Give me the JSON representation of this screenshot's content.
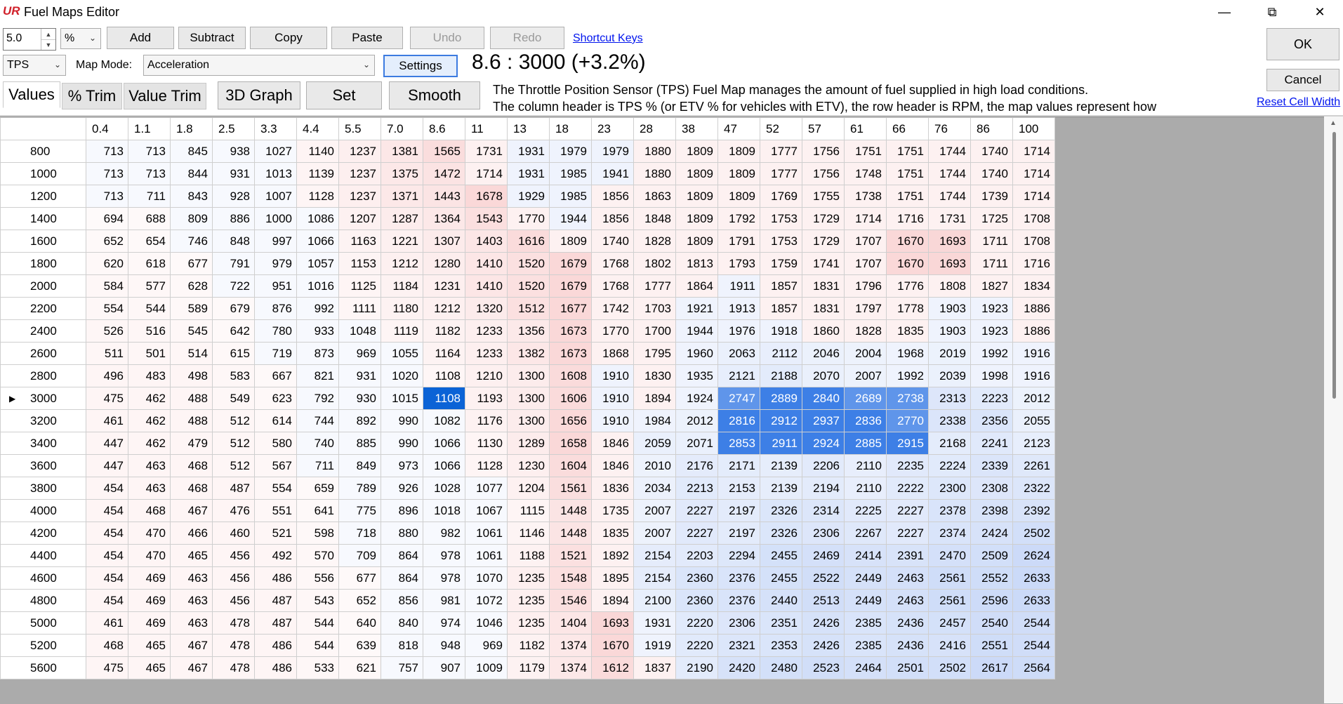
{
  "window": {
    "title": "Fuel Maps Editor",
    "logo": "UR",
    "minimize_label": "—",
    "restore_label": "⧉",
    "close_label": "✕"
  },
  "toolbar": {
    "step_value": "5.0",
    "unit": "%",
    "add_label": "Add",
    "subtract_label": "Subtract",
    "copy_label": "Copy",
    "paste_label": "Paste",
    "undo_label": "Undo",
    "redo_label": "Redo",
    "shortcut_keys_label": "Shortcut Keys",
    "ok_label": "OK",
    "cancel_label": "Cancel",
    "reset_cell_width_label": "Reset Cell Width"
  },
  "map_controls": {
    "sensor": "TPS",
    "map_mode_label": "Map Mode:",
    "map_mode_value": "Acceleration",
    "settings_label": "Settings",
    "readout": "8.6 : 3000 (+3.2%)"
  },
  "tabs": {
    "values": "Values",
    "pct_trim": "% Trim",
    "value_trim": "Value Trim"
  },
  "actions": {
    "graph3d": "3D Graph",
    "set": "Set",
    "smooth": "Smooth"
  },
  "description": {
    "line1": "The Throttle Position Sensor (TPS) Fuel Map manages the amount of fuel supplied in high load conditions.",
    "line2": "The column header is TPS % (or ETV % for vehicles with ETV), the row header is RPM, the map values represent how"
  },
  "grid": {
    "columns": [
      "0.4",
      "1.1",
      "1.8",
      "2.5",
      "3.3",
      "4.4",
      "5.5",
      "7.0",
      "8.6",
      "11",
      "13",
      "18",
      "23",
      "28",
      "38",
      "47",
      "52",
      "57",
      "61",
      "66",
      "76",
      "86",
      "100"
    ],
    "rows": [
      {
        "rpm": "800",
        "values": [
          713,
          713,
          845,
          938,
          1027,
          1140,
          1237,
          1381,
          1565,
          1731,
          1931,
          1979,
          1979,
          1880,
          1809,
          1809,
          1777,
          1756,
          1751,
          1751,
          1744,
          1740,
          1714
        ]
      },
      {
        "rpm": "1000",
        "values": [
          713,
          713,
          844,
          931,
          1013,
          1139,
          1237,
          1375,
          1472,
          1714,
          1931,
          1985,
          1941,
          1880,
          1809,
          1809,
          1777,
          1756,
          1748,
          1751,
          1744,
          1740,
          1714
        ]
      },
      {
        "rpm": "1200",
        "values": [
          713,
          711,
          843,
          928,
          1007,
          1128,
          1237,
          1371,
          1443,
          1678,
          1929,
          1985,
          1856,
          1863,
          1809,
          1809,
          1769,
          1755,
          1738,
          1751,
          1744,
          1739,
          1714
        ]
      },
      {
        "rpm": "1400",
        "values": [
          694,
          688,
          809,
          886,
          1000,
          1086,
          1207,
          1287,
          1364,
          1543,
          1770,
          1944,
          1856,
          1848,
          1809,
          1792,
          1753,
          1729,
          1714,
          1716,
          1731,
          1725,
          1708
        ]
      },
      {
        "rpm": "1600",
        "values": [
          652,
          654,
          746,
          848,
          997,
          1066,
          1163,
          1221,
          1307,
          1403,
          1616,
          1809,
          1740,
          1828,
          1809,
          1791,
          1753,
          1729,
          1707,
          1670,
          1693,
          1711,
          1708
        ]
      },
      {
        "rpm": "1800",
        "values": [
          620,
          618,
          677,
          791,
          979,
          1057,
          1153,
          1212,
          1280,
          1410,
          1520,
          1679,
          1768,
          1802,
          1813,
          1793,
          1759,
          1741,
          1707,
          1670,
          1693,
          1711,
          1716
        ]
      },
      {
        "rpm": "2000",
        "values": [
          584,
          577,
          628,
          722,
          951,
          1016,
          1125,
          1184,
          1231,
          1410,
          1520,
          1679,
          1768,
          1777,
          1864,
          1911,
          1857,
          1831,
          1796,
          1776,
          1808,
          1827,
          1834
        ]
      },
      {
        "rpm": "2200",
        "values": [
          554,
          544,
          589,
          679,
          876,
          992,
          1111,
          1180,
          1212,
          1320,
          1512,
          1677,
          1742,
          1703,
          1921,
          1913,
          1857,
          1831,
          1797,
          1778,
          1903,
          1923,
          1886
        ]
      },
      {
        "rpm": "2400",
        "values": [
          526,
          516,
          545,
          642,
          780,
          933,
          1048,
          1119,
          1182,
          1233,
          1356,
          1673,
          1770,
          1700,
          1944,
          1976,
          1918,
          1860,
          1828,
          1835,
          1903,
          1923,
          1886
        ]
      },
      {
        "rpm": "2600",
        "values": [
          511,
          501,
          514,
          615,
          719,
          873,
          969,
          1055,
          1164,
          1233,
          1382,
          1673,
          1868,
          1795,
          1960,
          2063,
          2112,
          2046,
          2004,
          1968,
          2019,
          1992,
          1916
        ]
      },
      {
        "rpm": "2800",
        "values": [
          496,
          483,
          498,
          583,
          667,
          821,
          931,
          1020,
          1108,
          1210,
          1300,
          1608,
          1910,
          1830,
          1935,
          2121,
          2188,
          2070,
          2007,
          1992,
          2039,
          1998,
          1916
        ]
      },
      {
        "rpm": "3000",
        "values": [
          475,
          462,
          488,
          549,
          623,
          792,
          930,
          1015,
          1108,
          1193,
          1300,
          1606,
          1910,
          1894,
          1924,
          2747,
          2889,
          2840,
          2689,
          2738,
          2313,
          2223,
          2012
        ],
        "current": true
      },
      {
        "rpm": "3200",
        "values": [
          461,
          462,
          488,
          512,
          614,
          744,
          892,
          990,
          1082,
          1176,
          1300,
          1656,
          1910,
          1984,
          2012,
          2816,
          2912,
          2937,
          2836,
          2770,
          2338,
          2356,
          2055
        ]
      },
      {
        "rpm": "3400",
        "values": [
          447,
          462,
          479,
          512,
          580,
          740,
          885,
          990,
          1066,
          1130,
          1289,
          1658,
          1846,
          2059,
          2071,
          2853,
          2911,
          2924,
          2885,
          2915,
          2168,
          2241,
          2123
        ]
      },
      {
        "rpm": "3600",
        "values": [
          447,
          463,
          468,
          512,
          567,
          711,
          849,
          973,
          1066,
          1128,
          1230,
          1604,
          1846,
          2010,
          2176,
          2171,
          2139,
          2206,
          2110,
          2235,
          2224,
          2339,
          2261
        ]
      },
      {
        "rpm": "3800",
        "values": [
          454,
          463,
          468,
          487,
          554,
          659,
          789,
          926,
          1028,
          1077,
          1204,
          1561,
          1836,
          2034,
          2213,
          2153,
          2139,
          2194,
          2110,
          2222,
          2300,
          2308,
          2322
        ]
      },
      {
        "rpm": "4000",
        "values": [
          454,
          468,
          467,
          476,
          551,
          641,
          775,
          896,
          1018,
          1067,
          1115,
          1448,
          1735,
          2007,
          2227,
          2197,
          2326,
          2314,
          2225,
          2227,
          2378,
          2398,
          2392
        ]
      },
      {
        "rpm": "4200",
        "values": [
          454,
          470,
          466,
          460,
          521,
          598,
          718,
          880,
          982,
          1061,
          1146,
          1448,
          1835,
          2007,
          2227,
          2197,
          2326,
          2306,
          2267,
          2227,
          2374,
          2424,
          2502
        ]
      },
      {
        "rpm": "4400",
        "values": [
          454,
          470,
          465,
          456,
          492,
          570,
          709,
          864,
          978,
          1061,
          1188,
          1521,
          1892,
          2154,
          2203,
          2294,
          2455,
          2469,
          2414,
          2391,
          2470,
          2509,
          2624
        ]
      },
      {
        "rpm": "4600",
        "values": [
          454,
          469,
          463,
          456,
          486,
          556,
          677,
          864,
          978,
          1070,
          1235,
          1548,
          1895,
          2154,
          2360,
          2376,
          2455,
          2522,
          2449,
          2463,
          2561,
          2552,
          2633
        ]
      },
      {
        "rpm": "4800",
        "values": [
          454,
          469,
          463,
          456,
          487,
          543,
          652,
          856,
          981,
          1072,
          1235,
          1546,
          1894,
          2100,
          2360,
          2376,
          2440,
          2513,
          2449,
          2463,
          2561,
          2596,
          2633
        ]
      },
      {
        "rpm": "5000",
        "values": [
          461,
          469,
          463,
          478,
          487,
          544,
          640,
          840,
          974,
          1046,
          1235,
          1404,
          1693,
          1931,
          2220,
          2306,
          2351,
          2426,
          2385,
          2436,
          2457,
          2540,
          2544
        ]
      },
      {
        "rpm": "5200",
        "values": [
          468,
          465,
          467,
          478,
          486,
          544,
          639,
          818,
          948,
          969,
          1182,
          1374,
          1670,
          1919,
          2220,
          2321,
          2353,
          2426,
          2385,
          2436,
          2416,
          2551,
          2544
        ]
      },
      {
        "rpm": "5600",
        "values": [
          475,
          465,
          467,
          478,
          486,
          533,
          621,
          757,
          907,
          1009,
          1179,
          1374,
          1612,
          1837,
          2190,
          2420,
          2480,
          2523,
          2464,
          2501,
          2502,
          2617,
          2564
        ]
      }
    ],
    "selected_cell": {
      "row": "3000",
      "col": "8.6"
    },
    "highlighted_cells": [
      [
        11,
        15
      ],
      [
        11,
        16
      ],
      [
        11,
        17
      ],
      [
        11,
        18
      ],
      [
        11,
        19
      ],
      [
        12,
        15
      ],
      [
        12,
        16
      ],
      [
        12,
        17
      ],
      [
        12,
        18
      ],
      [
        12,
        19
      ],
      [
        13,
        15
      ],
      [
        13,
        16
      ],
      [
        13,
        17
      ],
      [
        13,
        18
      ],
      [
        13,
        19
      ]
    ],
    "colors": {
      "selected": "#0b63d6",
      "highlight_strong": "#3d7fe6",
      "highlight_mid": "#5f95ea"
    }
  }
}
